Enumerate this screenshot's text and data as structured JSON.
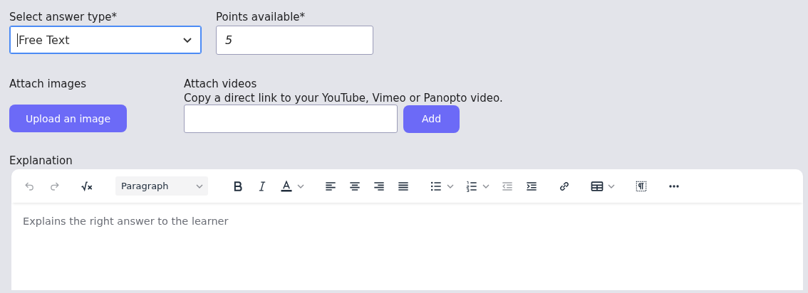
{
  "answer_type": {
    "label": "Select answer type*",
    "value": "Free Text",
    "focused": true
  },
  "points": {
    "label": "Points available*",
    "value": "5"
  },
  "attach_images": {
    "label": "Attach images",
    "button": "Upload an image"
  },
  "attach_videos": {
    "label": "Attach videos",
    "hint": "Copy a direct link to your YouTube, Vimeo or Panopto video.",
    "button": "Add"
  },
  "explanation": {
    "label": "Explanation",
    "placeholder": "Explains the right answer to the learner",
    "toolbar": [
      [
        {
          "kind": "undo",
          "disabled": true
        },
        {
          "kind": "redo",
          "disabled": true
        }
      ],
      [
        {
          "kind": "math",
          "disabled": false
        }
      ],
      [
        {
          "kind": "format",
          "value": "Paragraph",
          "disabled": false
        }
      ],
      [
        {
          "kind": "bold",
          "disabled": false
        },
        {
          "kind": "italic",
          "disabled": false
        },
        {
          "kind": "textcolor",
          "disabled": false,
          "dropdown": true
        }
      ],
      [
        {
          "kind": "alignleft",
          "disabled": false
        },
        {
          "kind": "aligncenter",
          "disabled": false
        },
        {
          "kind": "alignright",
          "disabled": false
        },
        {
          "kind": "justify",
          "disabled": false
        }
      ],
      [
        {
          "kind": "bullets",
          "disabled": false,
          "dropdown": true
        },
        {
          "kind": "numbers",
          "disabled": false,
          "dropdown": true
        },
        {
          "kind": "outdent",
          "disabled": true
        },
        {
          "kind": "indent",
          "disabled": false
        }
      ],
      [
        {
          "kind": "link",
          "disabled": false
        }
      ],
      [
        {
          "kind": "table",
          "disabled": false,
          "dropdown": true
        }
      ],
      [
        {
          "kind": "blocks",
          "disabled": false
        }
      ],
      [
        {
          "kind": "more",
          "disabled": false
        }
      ]
    ]
  }
}
